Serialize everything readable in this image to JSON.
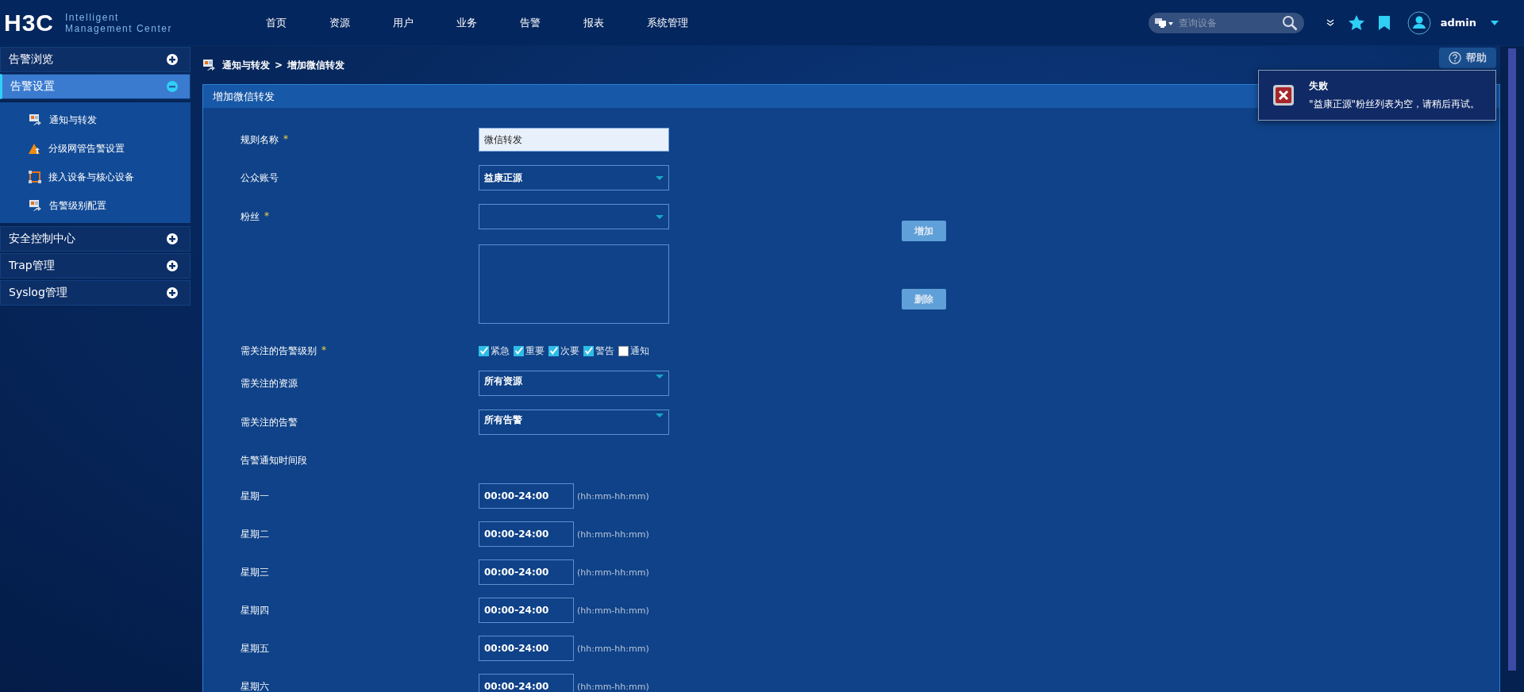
{
  "header": {
    "logo": "H3C",
    "logo_lines": [
      [
        "Intelligent"
      ],
      [
        "Management",
        "Center"
      ]
    ],
    "nav": [
      {
        "label": "首页"
      },
      {
        "label": "资源"
      },
      {
        "label": "用户"
      },
      {
        "label": "业务"
      },
      {
        "label": "告警"
      },
      {
        "label": "报表"
      },
      {
        "label": "系统管理"
      }
    ],
    "search": {
      "placeholder": "查询设备"
    },
    "user": "admin"
  },
  "sidebar": {
    "items": [
      {
        "label": "告警浏览",
        "expanded": false,
        "selected": false
      },
      {
        "label": "告警设置",
        "expanded": true,
        "selected": true,
        "children": [
          {
            "label": "通知与转发"
          },
          {
            "label": "分级网管告警设置"
          },
          {
            "label": "接入设备与核心设备"
          },
          {
            "label": "告警级别配置"
          }
        ]
      },
      {
        "label": "安全控制中心",
        "expanded": false,
        "selected": false
      },
      {
        "label": "Trap管理",
        "expanded": false,
        "selected": false
      },
      {
        "label": "Syslog管理",
        "expanded": false,
        "selected": false
      }
    ]
  },
  "breadcrumb": {
    "items": [
      "通知与转发",
      "增加微信转发"
    ],
    "separator": ">"
  },
  "help_button": "帮助",
  "panel": {
    "title": "增加微信转发",
    "rows": [
      {
        "kind": "text",
        "label": "规则名称",
        "required_mark": "*",
        "value": "微信转发"
      },
      {
        "kind": "select",
        "label": "公众账号",
        "value": "益康正源"
      },
      {
        "kind": "list",
        "label": "粉丝",
        "required_mark": "*",
        "buttons": [
          "增加",
          "删除"
        ]
      },
      {
        "kind": "checks",
        "label": "需关注的告警级别",
        "required_mark": "*",
        "options": [
          {
            "label": "紧急",
            "checked": true
          },
          {
            "label": "重要",
            "checked": true
          },
          {
            "label": "次要",
            "checked": true
          },
          {
            "label": "警告",
            "checked": true
          },
          {
            "label": "通知",
            "checked": false
          }
        ]
      },
      {
        "kind": "select",
        "label": "需关注的资源",
        "value": "所有资源"
      },
      {
        "kind": "select",
        "label": "需关注的告警",
        "value": "所有告警"
      },
      {
        "kind": "heading",
        "label": "告警通知时间段"
      },
      {
        "kind": "time",
        "label": "星期一",
        "value": "00:00-24:00",
        "hint": "(hh:mm-hh:mm)"
      },
      {
        "kind": "time",
        "label": "星期二",
        "value": "00:00-24:00",
        "hint": "(hh:mm-hh:mm)"
      },
      {
        "kind": "time",
        "label": "星期三",
        "value": "00:00-24:00",
        "hint": "(hh:mm-hh:mm)"
      },
      {
        "kind": "time",
        "label": "星期四",
        "value": "00:00-24:00",
        "hint": "(hh:mm-hh:mm)"
      },
      {
        "kind": "time",
        "label": "星期五",
        "value": "00:00-24:00",
        "hint": "(hh:mm-hh:mm)"
      },
      {
        "kind": "time",
        "label": "星期六",
        "value": "00:00-24:00",
        "hint": "(hh:mm-hh:mm)"
      }
    ]
  },
  "toast": {
    "title": "失败",
    "message": "\"益康正源\"粉丝列表为空，请稍后再试。"
  }
}
